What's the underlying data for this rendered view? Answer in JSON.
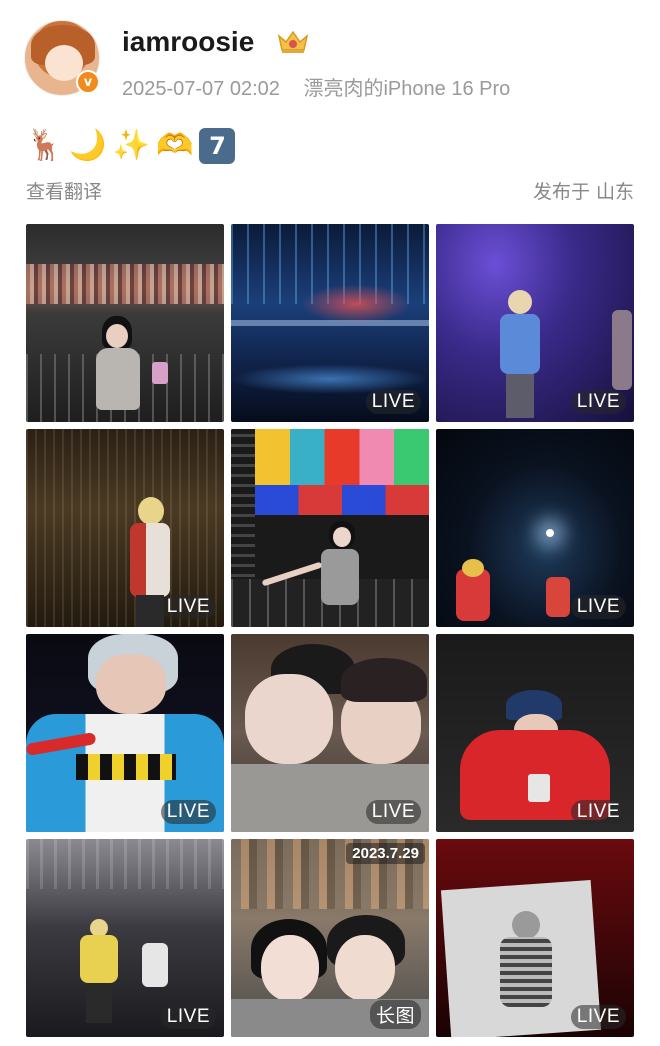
{
  "post": {
    "username": "iamroosie",
    "timestamp": "2025-07-07 02:02",
    "device": "漂亮肉的iPhone 16 Pro",
    "emojis": [
      "🦌",
      "🌙",
      "✨",
      "🫶",
      "7"
    ],
    "translate_label": "查看翻译",
    "location_label": "发布于 山东"
  },
  "icons": {
    "verified": "v",
    "crown": "crown-badge-icon"
  },
  "photos": [
    {
      "badge": ""
    },
    {
      "badge": "LIVE"
    },
    {
      "badge": "LIVE"
    },
    {
      "badge": "LIVE"
    },
    {
      "badge": ""
    },
    {
      "badge": "LIVE"
    },
    {
      "badge": "LIVE"
    },
    {
      "badge": "LIVE"
    },
    {
      "badge": "LIVE"
    },
    {
      "badge": "LIVE"
    },
    {
      "badge": "长图",
      "date": "2023.7.29"
    },
    {
      "badge": "LIVE"
    }
  ],
  "colors": {
    "accent_orange": "#f28b1c",
    "meta_gray": "#9a9a9a"
  }
}
